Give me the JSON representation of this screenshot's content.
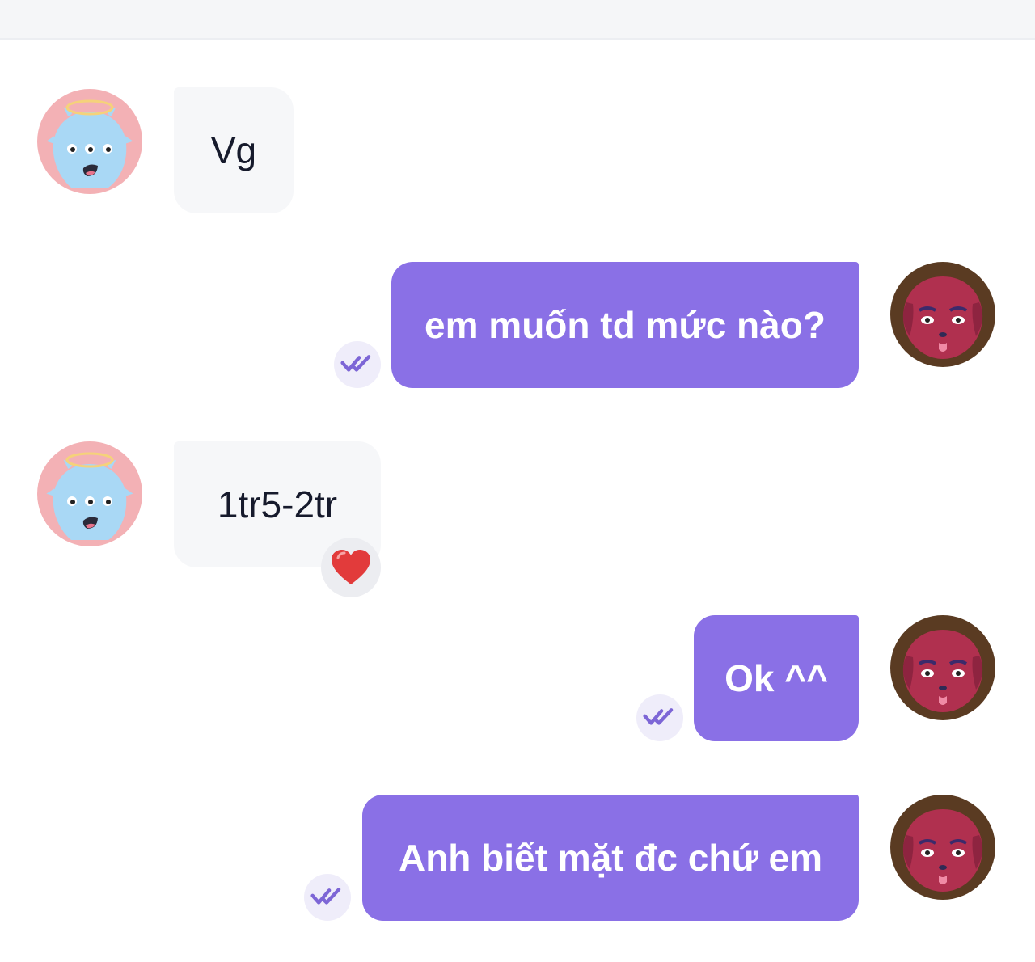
{
  "colors": {
    "outgoing_bubble": "#8a70e6",
    "incoming_bubble": "#f6f7f9",
    "read_badge_bg": "#efedfa",
    "read_check": "#7d66d6"
  },
  "messages": [
    {
      "direction": "incoming",
      "text": "Vg",
      "avatar": "blue-monster-avatar"
    },
    {
      "direction": "outgoing",
      "text": "em muốn td mức nào?",
      "status_icon": "double-check-icon",
      "avatar": "red-dog-avatar"
    },
    {
      "direction": "incoming",
      "text": "1tr5-2tr",
      "reaction": "heart-icon",
      "avatar": "blue-monster-avatar"
    },
    {
      "direction": "outgoing",
      "text": "Ok ^^",
      "status_icon": "double-check-icon",
      "avatar": "red-dog-avatar"
    },
    {
      "direction": "outgoing",
      "text": "Anh biết mặt đc chứ em",
      "status_icon": "double-check-icon",
      "avatar": "red-dog-avatar"
    }
  ]
}
